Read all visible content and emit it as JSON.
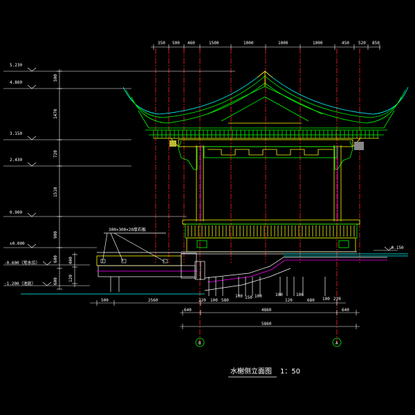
{
  "title": "水榭侧立面图",
  "scale": "1：50",
  "top_dimensions": [
    "350",
    "500",
    "460",
    "1500",
    "1000",
    "1000",
    "1000",
    "450",
    "520",
    "850"
  ],
  "elevations": [
    "5.230",
    "4.860",
    "3.150",
    "2.430",
    "0.900",
    "±0.000",
    "-0.600（常水位）",
    "-1.200（池底）",
    "-0.150"
  ],
  "vertical_dimensions": [
    "500",
    "1470",
    "720",
    "1510",
    "900",
    "400",
    "600",
    "120"
  ],
  "bottom_dimensions": [
    "500",
    "2560",
    "220",
    "100",
    "580",
    "100",
    "150",
    "100",
    "100",
    "120",
    "100",
    "680",
    "100",
    "220",
    "640",
    "4860",
    "640",
    "5860"
  ],
  "axis_labels": [
    "B",
    "A"
  ],
  "annotation": "300×300×20厚石板"
}
